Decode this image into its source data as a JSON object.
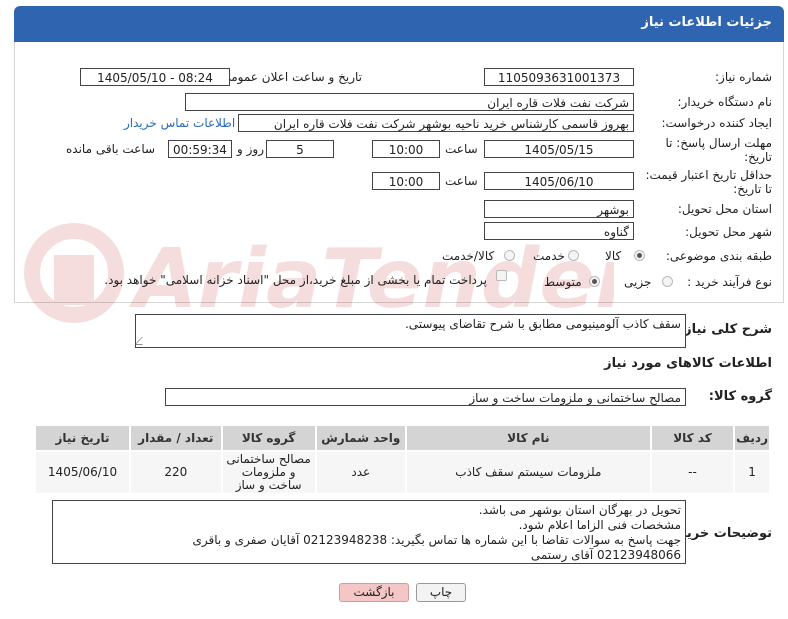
{
  "header": {
    "title": "جزئیات اطلاعات نیاز"
  },
  "labels": {
    "need_number": "شماره نیاز:",
    "announce_datetime": "تاریخ و ساعت اعلان عمومی:",
    "buyer_org": "نام دستگاه خریدار:",
    "requester": "ایجاد کننده درخواست:",
    "reply_deadline": "مهلت ارسال پاسخ: تا تاریخ:",
    "time_word": "ساعت",
    "day_and": "روز و",
    "time_remaining": "ساعت باقی مانده",
    "price_validity": "حداقل تاریخ اعتبار قیمت: تا تاریخ:",
    "time_word2": "ساعت",
    "province": "استان محل تحویل:",
    "city": "شهر محل تحویل:",
    "category": "طبقه بندی موضوعی:",
    "purchase_type": "نوع فرآیند خرید :",
    "need_desc": "شرح کلی نیاز:",
    "goods_info": "اطلاعات کالاهای مورد نیاز",
    "goods_group": "گروه کالا:",
    "buyer_notes": "توضیحات خریدار:"
  },
  "fields": {
    "need_number": "1105093631001373",
    "announce_datetime": "1405/05/10 - 08:24",
    "buyer_org": "شرکت نفت فلات قاره ایران",
    "requester": "بهروز قاسمی کارشناس خرید ناحیه بوشهر شرکت نفت فلات قاره ایران",
    "buyer_contact_link": "اطلاعات تماس خریدار",
    "reply_date": "1405/05/15",
    "reply_time": "10:00",
    "reply_days": "5",
    "reply_remaining": "00:59:34",
    "validity_date": "1405/06/10",
    "validity_time": "10:00",
    "province": "بوشهر",
    "city": "گناوه",
    "need_desc": "سقف کاذب آلومینیومی مطابق با شرح تقاضای پیوستی.",
    "goods_group": "مصالح ساختمانی و ملزومات ساخت و ساز"
  },
  "category_options": [
    {
      "label": "کالا",
      "selected": true
    },
    {
      "label": "خدمت",
      "selected": false
    },
    {
      "label": "کالا/خدمت",
      "selected": false
    }
  ],
  "purchase_options": [
    {
      "label": "جزیی",
      "selected": false
    },
    {
      "label": "متوسط",
      "selected": true
    }
  ],
  "payment_note": "پرداخت تمام یا بخشی از مبلغ خرید،از محل \"اسناد خزانه اسلامی\" خواهد بود.",
  "table": {
    "headers": [
      "ردیف",
      "کد کالا",
      "نام کالا",
      "واحد شمارش",
      "گروه کالا",
      "تعداد / مقدار",
      "تاریخ نیاز"
    ],
    "rows": [
      [
        "1",
        "--",
        "ملزومات سیستم سقف کاذب",
        "عدد",
        "مصالح ساختمانی و ملزومات ساخت و ساز",
        "220",
        "1405/06/10"
      ]
    ]
  },
  "buyer_notes_lines": [
    "تحویل در بهرگان استان بوشهر می باشد.",
    "مشخصات فنی الزاما اعلام شود.",
    "جهت پاسخ به سوالات تقاضا با این شماره ها تماس بگیرید: 02123948238 آقایان صفری و باقری",
    "02123948066 آقای رستمی"
  ],
  "buttons": {
    "print": "چاپ",
    "back": "بازگشت"
  },
  "watermark_text": "AriaTender.net",
  "colors": {
    "header_bg": "#2f64b0",
    "link": "#2a6ab8",
    "back_btn_bg": "#f5c6c6"
  }
}
